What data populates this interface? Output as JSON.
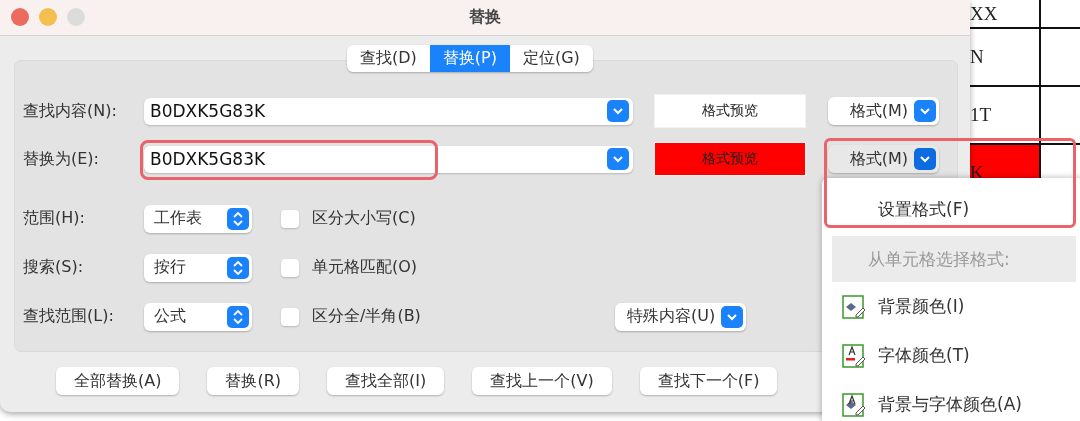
{
  "sheet": {
    "rows": [
      {
        "text": "XX",
        "color": "#ffffff"
      },
      {
        "text": "N",
        "color": "#ffffff"
      },
      {
        "text": "1T",
        "color": "#ffffff"
      },
      {
        "text": "K",
        "color": "#ff0000"
      }
    ]
  },
  "window": {
    "title": "替换"
  },
  "tabs": [
    {
      "label": "查找(D)",
      "selected": false
    },
    {
      "label": "替换(P)",
      "selected": true
    },
    {
      "label": "定位(G)",
      "selected": false
    }
  ],
  "fields": [
    {
      "label": "查找内容(N):",
      "value": "B0DXK5G83K",
      "preview": "格式预览",
      "color": "#ffffff",
      "format_button": "格式(M)",
      "pressed": false,
      "highlighted": false
    },
    {
      "label": "替换为(E):",
      "value": "B0DXK5G83K",
      "preview": "格式预览",
      "color": "#ff0000",
      "format_button": "格式(M)",
      "pressed": true,
      "highlighted": true
    }
  ],
  "options": [
    {
      "label": "范围(H):",
      "value": "工作表",
      "checkbox": "区分大小写(C)",
      "checked": false
    },
    {
      "label": "搜索(S):",
      "value": "按行",
      "checkbox": "单元格匹配(O)",
      "checked": false
    },
    {
      "label": "查找范围(L):",
      "value": "公式",
      "checkbox": "区分全/半角(B)",
      "checked": false
    }
  ],
  "special_button": "特殊内容(U)",
  "buttons": [
    "全部替换(A)",
    "替换(R)",
    "查找全部(I)",
    "查找上一个(V)",
    "查找下一个(F)"
  ],
  "menu": {
    "items": [
      {
        "kind": "item",
        "label": "设置格式(F)",
        "highlighted": true
      },
      {
        "kind": "header",
        "label": "从单元格选择格式:"
      },
      {
        "kind": "background",
        "label": "背景颜色(I)"
      },
      {
        "kind": "font",
        "label": "字体颜色(T)"
      },
      {
        "kind": "both",
        "label": "背景与字体颜色(A)"
      }
    ]
  }
}
